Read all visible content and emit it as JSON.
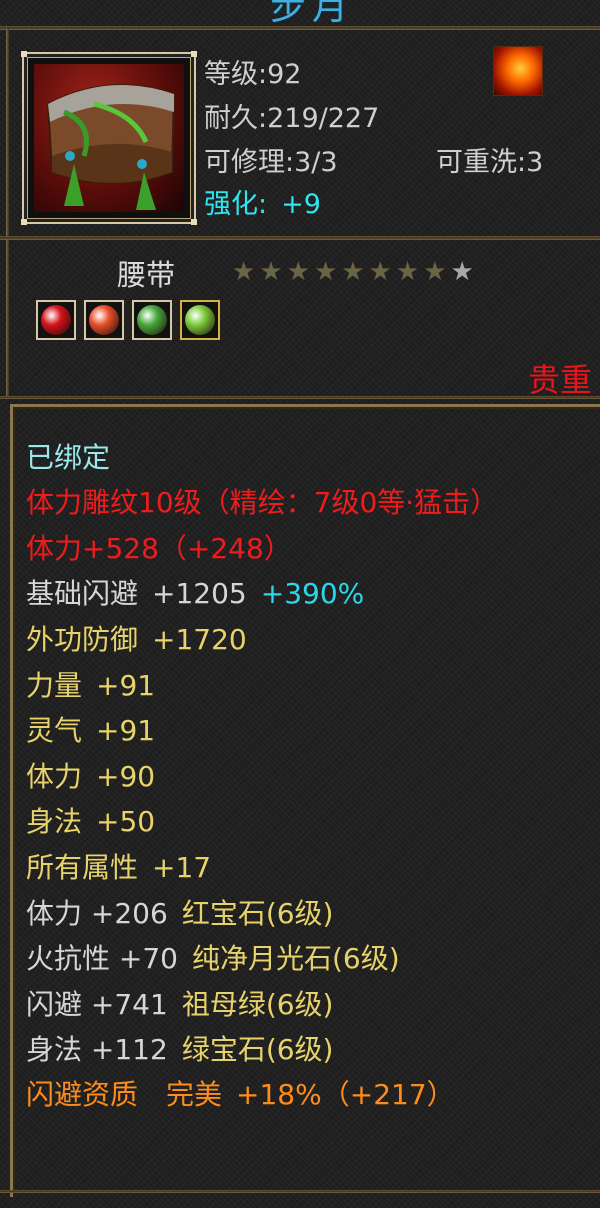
{
  "header": {
    "title_partial": "步月"
  },
  "item": {
    "level": "等级:92",
    "durability": "耐久:219/227",
    "repair": "可修理:3/3",
    "rewash": "可重洗:3",
    "enhance_label": "强化:",
    "enhance_value": "+9",
    "name": "腰带",
    "star_count": 9,
    "stars_filled": 8,
    "quality": "贵重",
    "gem_slots": [
      {
        "icon": "red-gem-icon",
        "color": "#d4141a"
      },
      {
        "icon": "fire-slash-gem-icon",
        "color": "#e8502a"
      },
      {
        "icon": "green-gem-icon",
        "color": "#48a83a"
      },
      {
        "icon": "light-green-gem-icon",
        "color": "#7ccc3a"
      }
    ]
  },
  "details": {
    "bound": "已绑定",
    "engrave": "体力雕纹10级（精绘：7级0等·猛击）",
    "stamina_base": "体力+528（+248）",
    "dodge_label": "基础闪避",
    "dodge_value": "+1205",
    "dodge_bonus": "+390%",
    "defense_label": "外功防御",
    "defense_value": "+1720",
    "strength_label": "力量",
    "strength_value": "+91",
    "spirit_label": "灵气",
    "spirit_value": "+91",
    "stamina_label": "体力",
    "stamina_value": "+90",
    "agility_label": "身法",
    "agility_value": "+50",
    "all_attr_label": "所有属性",
    "all_attr_value": "+17",
    "gem1_stat": "体力 +206",
    "gem1_name": "红宝石(6级)",
    "gem2_stat": "火抗性 +70",
    "gem2_name": "纯净月光石(6级)",
    "gem3_stat": "闪避 +741",
    "gem3_name": "祖母绿(6级)",
    "gem4_stat": "身法 +112",
    "gem4_name": "绿宝石(6级)",
    "aptitude_label": "闪避资质",
    "aptitude_grade": "完美",
    "aptitude_value": "+18%（+217）"
  }
}
